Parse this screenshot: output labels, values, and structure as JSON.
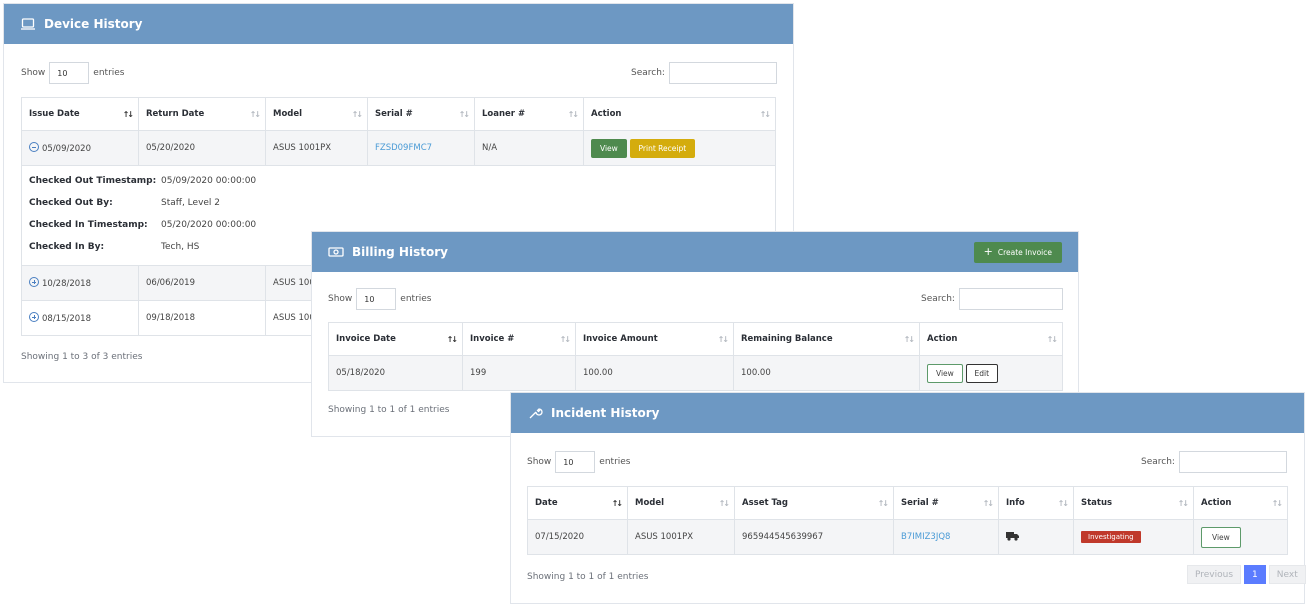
{
  "device": {
    "title": "Device History",
    "show_label": "Show",
    "entries_value": "10",
    "entries_label": "entries",
    "search_label": "Search:",
    "columns": [
      "Issue Date",
      "Return Date",
      "Model",
      "Serial #",
      "Loaner #",
      "Action"
    ],
    "rows": [
      {
        "issue": "05/09/2020",
        "return": "05/20/2020",
        "model": "ASUS 1001PX",
        "serial": "FZSD09FMC7",
        "loaner": "N/A"
      },
      {
        "issue": "10/28/2018",
        "return": "06/06/2019",
        "model": "ASUS 100"
      },
      {
        "issue": "08/15/2018",
        "return": "09/18/2018",
        "model": "ASUS 100"
      }
    ],
    "view_label": "View",
    "print_label": "Print Receipt",
    "details": {
      "checked_out_ts_label": "Checked Out Timestamp:",
      "checked_out_ts": "05/09/2020 00:00:00",
      "checked_out_by_label": "Checked Out By:",
      "checked_out_by": "Staff, Level 2",
      "checked_in_ts_label": "Checked In Timestamp:",
      "checked_in_ts": "05/20/2020 00:00:00",
      "checked_in_by_label": "Checked In By:",
      "checked_in_by": "Tech, HS"
    },
    "footer": "Showing 1 to 3 of 3 entries"
  },
  "billing": {
    "title": "Billing History",
    "create_label": "Create Invoice",
    "show_label": "Show",
    "entries_value": "10",
    "entries_label": "entries",
    "search_label": "Search:",
    "columns": [
      "Invoice Date",
      "Invoice #",
      "Invoice Amount",
      "Remaining Balance",
      "Action"
    ],
    "row": {
      "date": "05/18/2020",
      "number": "199",
      "amount": "100.00",
      "balance": "100.00"
    },
    "view_label": "View",
    "edit_label": "Edit",
    "footer": "Showing 1 to 1 of 1 entries"
  },
  "incident": {
    "title": "Incident History",
    "show_label": "Show",
    "entries_value": "10",
    "entries_label": "entries",
    "search_label": "Search:",
    "columns": [
      "Date",
      "Model",
      "Asset Tag",
      "Serial #",
      "Info",
      "Status",
      "Action"
    ],
    "row": {
      "date": "07/15/2020",
      "model": "ASUS 1001PX",
      "asset_tag": "965944545639967",
      "serial": "B7IMIZ3JQ8",
      "status": "Investigating"
    },
    "view_label": "View",
    "footer": "Showing 1 to 1 of 1 entries",
    "pager": {
      "previous": "Previous",
      "page": "1",
      "next": "Next"
    }
  },
  "colors": {
    "header": "#6d98c3",
    "link": "#4a9bd6",
    "badge": "#c0392b",
    "page_active": "#5b7cff"
  }
}
